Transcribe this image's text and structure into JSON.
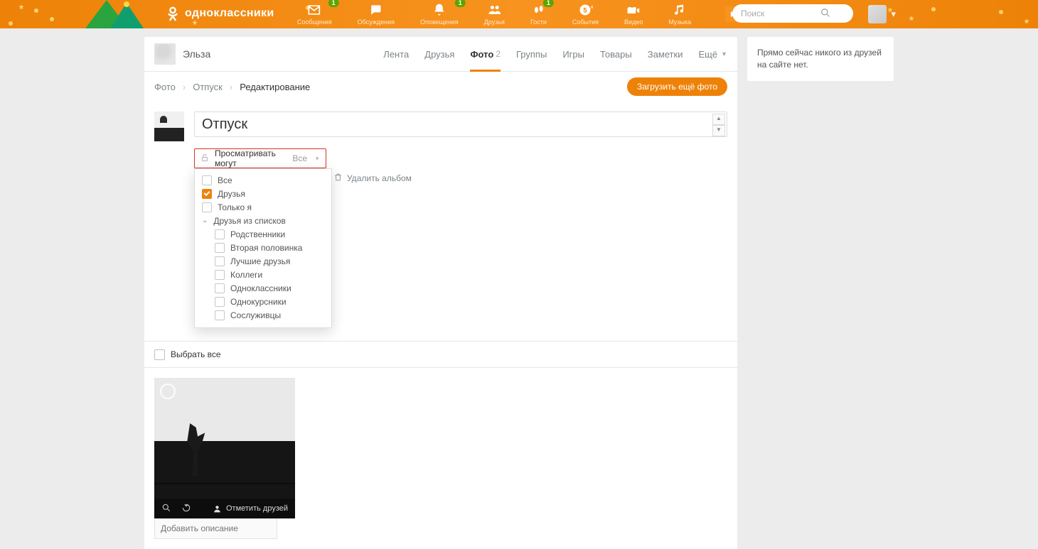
{
  "brand": {
    "name": "одноклассники"
  },
  "topnav": {
    "items": [
      {
        "key": "messages",
        "label": "Сообщения",
        "badge": "1"
      },
      {
        "key": "discussions",
        "label": "Обсуждения"
      },
      {
        "key": "notifications",
        "label": "Оповещения",
        "badge": "1"
      },
      {
        "key": "friends",
        "label": "Друзья"
      },
      {
        "key": "guests",
        "label": "Гости",
        "badge": "1"
      },
      {
        "key": "events",
        "label": "События"
      },
      {
        "key": "video",
        "label": "Видео"
      },
      {
        "key": "music",
        "label": "Музыка"
      }
    ]
  },
  "search": {
    "placeholder": "Поиск"
  },
  "profile": {
    "name": "Эльза",
    "tabs": {
      "feed": "Лента",
      "friends": "Друзья",
      "photos": "Фото",
      "photos_count": "2",
      "groups": "Группы",
      "games": "Игры",
      "market": "Товары",
      "notes": "Заметки",
      "more": "Ещё"
    }
  },
  "breadcrumb": {
    "root": "Фото",
    "album": "Отпуск",
    "current": "Редактирование"
  },
  "buttons": {
    "upload_more": "Загрузить ещё фото"
  },
  "album": {
    "title": "Отпуск",
    "privacy_label": "Просматривать могут",
    "privacy_value": "Все",
    "options": {
      "all": "Все",
      "friends": "Друзья",
      "only_me": "Только я",
      "from_lists": "Друзья из списков",
      "lists": {
        "relatives": "Родственники",
        "partner": "Вторая половинка",
        "best": "Лучшие друзья",
        "colleagues": "Коллеги",
        "classmates": "Одноклассники",
        "coursemates": "Однокурсники",
        "comrades": "Сослуживцы"
      }
    },
    "delete_link": "Удалить альбом",
    "select_all": "Выбрать все",
    "tag_friends": "Отметить друзей",
    "caption_placeholder": "Добавить описание"
  },
  "sidebar": {
    "no_friends_online": "Прямо сейчас никого из друзей на сайте нет."
  }
}
